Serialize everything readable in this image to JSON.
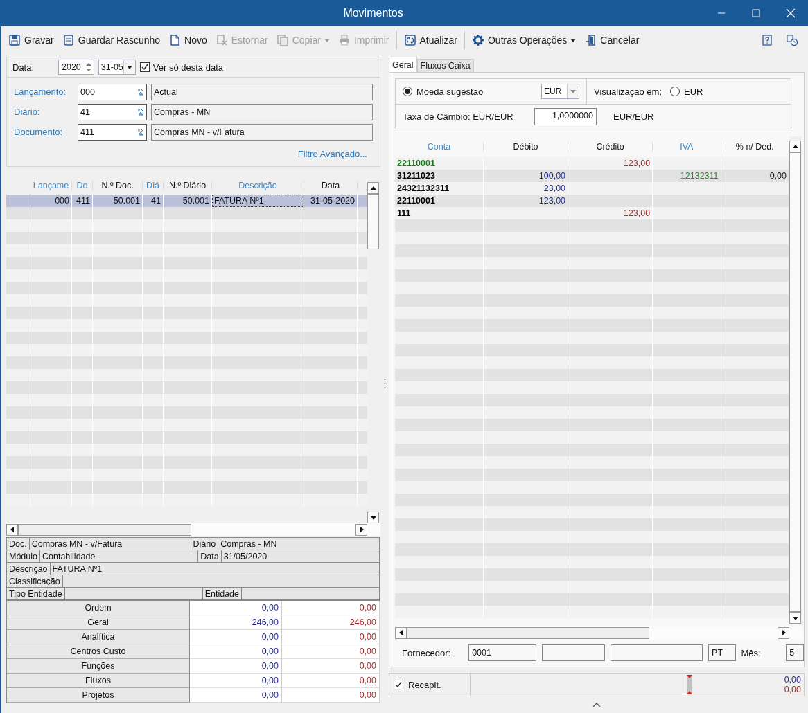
{
  "window": {
    "title": "Movimentos"
  },
  "toolbar": [
    {
      "kind": "save",
      "label": "Gravar",
      "disabled": false,
      "dropdown": false
    },
    {
      "kind": "draft",
      "label": "Guardar Rascunho",
      "disabled": false,
      "dropdown": false
    },
    {
      "kind": "new",
      "label": "Novo",
      "disabled": false,
      "dropdown": false
    },
    {
      "kind": "reverse",
      "label": "Estornar",
      "disabled": true,
      "dropdown": false
    },
    {
      "kind": "copy",
      "label": "Copiar",
      "disabled": true,
      "dropdown": true
    },
    {
      "kind": "print",
      "label": "Imprimir",
      "disabled": true,
      "dropdown": false,
      "separator_after": true
    },
    {
      "kind": "refresh",
      "label": "Atualizar",
      "disabled": false,
      "dropdown": false,
      "separator_after": true
    },
    {
      "kind": "gear",
      "label": "Outras Operações",
      "disabled": false,
      "dropdown": true
    },
    {
      "kind": "exit",
      "label": "Cancelar",
      "disabled": false,
      "dropdown": false
    }
  ],
  "toolbar_right": [
    {
      "kind": "help"
    },
    {
      "kind": "history"
    }
  ],
  "date_filter": {
    "label": "Data:",
    "year": "2020",
    "day_month": "31-05",
    "only_this_date": {
      "label": "Ver só desta data",
      "checked": true
    }
  },
  "filters": [
    {
      "label": "Lançamento:",
      "code": "000",
      "description": "Actual"
    },
    {
      "label": "Diário:",
      "code": "41",
      "description": "Compras - MN"
    },
    {
      "label": "Documento:",
      "code": "411",
      "description": "Compras MN - v/Fatura"
    }
  ],
  "advanced_filter_link": "Filtro Avançado...",
  "entries_table": {
    "columns": [
      {
        "label": "Lançame",
        "linked": true
      },
      {
        "label": "Do",
        "linked": true
      },
      {
        "label": "N.º Doc.",
        "linked": false
      },
      {
        "label": "Diá",
        "linked": true
      },
      {
        "label": "N.º Diário",
        "linked": false
      },
      {
        "label": "Descrição",
        "linked": true
      },
      {
        "label": "Data",
        "linked": false
      }
    ],
    "rows": [
      {
        "cells": [
          "000",
          "411",
          "50.001",
          "41",
          "50.001",
          "FATURA Nº1",
          "31-05-2020"
        ],
        "selected": true
      }
    ]
  },
  "document_info": [
    [
      {
        "label": "Doc.",
        "value": "Compras MN - v/Fatura"
      },
      {
        "label": "Diário",
        "value": "Compras - MN"
      }
    ],
    [
      {
        "label": "Módulo",
        "value": "Contabilidade"
      },
      {
        "label": "Data",
        "value": "31/05/2020"
      }
    ],
    [
      {
        "label": "Descrição",
        "value": "FATURA Nº1"
      }
    ],
    [
      {
        "label": "Classificação"
      }
    ],
    [
      {
        "label": "Tipo Entidade"
      },
      {
        "label": "Entidade"
      }
    ]
  ],
  "totals": [
    {
      "label": "Ordem",
      "debit": "0,00",
      "credit": "0,00"
    },
    {
      "label": "Geral",
      "debit": "246,00",
      "credit": "246,00"
    },
    {
      "label": "Analítica",
      "debit": "0,00",
      "credit": "0,00"
    },
    {
      "label": "Centros Custo",
      "debit": "0,00",
      "credit": "0,00"
    },
    {
      "label": "Funções",
      "debit": "0,00",
      "credit": "0,00"
    },
    {
      "label": "Fluxos",
      "debit": "0,00",
      "credit": "0,00"
    },
    {
      "label": "Projetos",
      "debit": "0,00",
      "credit": "0,00"
    }
  ],
  "tabs": [
    {
      "label": "Geral",
      "selected": true
    },
    {
      "label": "Fluxos Caixa",
      "selected": false
    }
  ],
  "currency": {
    "suggested": {
      "label": "Moeda sugestão",
      "selected": true
    },
    "currency_select": "EUR",
    "view_label": "Visualização em:",
    "view_option": {
      "label": "EUR",
      "selected": false
    },
    "rate_label": "Taxa de Câmbio: EUR/EUR",
    "rate": "1,0000000",
    "rate_unit": "EUR/EUR"
  },
  "lines_table": {
    "columns": [
      {
        "label": "Conta",
        "linked": true
      },
      {
        "label": "Débito",
        "linked": false
      },
      {
        "label": "Crédito",
        "linked": false
      },
      {
        "label": "IVA",
        "linked": true
      },
      {
        "label": "% n/ Ded.",
        "linked": false
      }
    ],
    "rows": [
      {
        "account": "22110001",
        "color": "#1a7a1a",
        "credit": "123,00"
      },
      {
        "account": "31211023",
        "color": "#000000",
        "debit": "100,00",
        "vat": "12132311",
        "non_deductible": "0,00"
      },
      {
        "account": "24321132311",
        "color": "#000000",
        "debit": "23,00"
      },
      {
        "account": "22110001",
        "color": "#000000",
        "debit": "123,00"
      },
      {
        "account": "111",
        "color": "#000000",
        "credit": "123,00"
      }
    ]
  },
  "supplier": {
    "label": "Fornecedor:",
    "code": "0001",
    "country": "PT",
    "month_label": "Mês:",
    "month": "5"
  },
  "recap": {
    "label": "Recapit.",
    "checked": true,
    "debit": "0,00",
    "credit": "0,00"
  }
}
